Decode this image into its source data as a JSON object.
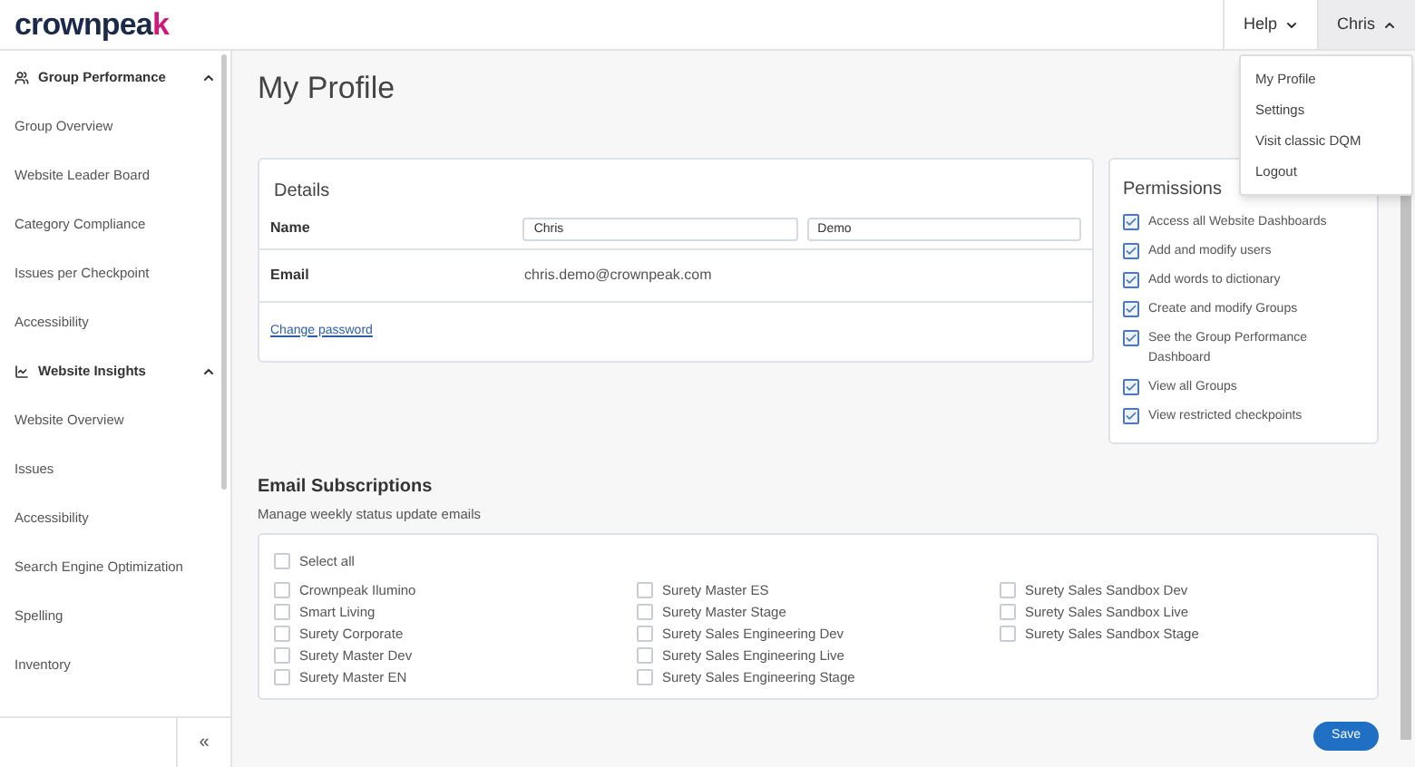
{
  "logo": {
    "text": "crownpea",
    "accent": "k"
  },
  "header_menus": [
    {
      "label": "Help",
      "expanded": false
    },
    {
      "label": "Chris",
      "expanded": true
    }
  ],
  "user_menu": {
    "items": [
      "My Profile",
      "Settings",
      "Visit classic DQM",
      "Logout"
    ]
  },
  "sidebar": {
    "sections": [
      {
        "title": "Group Performance",
        "kind": "people",
        "expanded": true,
        "items": [
          "Group Overview",
          "Website Leader Board",
          "Category Compliance",
          "Issues per Checkpoint",
          "Accessibility"
        ]
      },
      {
        "title": "Website Insights",
        "kind": "insights",
        "expanded": true,
        "items": [
          "Website Overview",
          "Issues",
          "Accessibility",
          "Search Engine Optimization",
          "Spelling",
          "Inventory"
        ]
      }
    ],
    "collapse_label": "«"
  },
  "page_title": "My Profile",
  "details": {
    "title": "Details",
    "name_label": "Name",
    "first_name": "Chris",
    "last_name": "Demo",
    "email_label": "Email",
    "email": "chris.demo@crownpeak.com",
    "change_password": "Change password"
  },
  "permissions": {
    "title": "Permissions",
    "items": [
      {
        "label": "Access all Website Dashboards",
        "checked": true
      },
      {
        "label": "Add and modify users",
        "checked": true
      },
      {
        "label": "Add words to dictionary",
        "checked": true
      },
      {
        "label": "Create and modify Groups",
        "checked": true
      },
      {
        "label": "See the Group Performance Dashboard",
        "checked": true
      },
      {
        "label": "View all Groups",
        "checked": true
      },
      {
        "label": "View restricted checkpoints",
        "checked": true
      }
    ]
  },
  "email_subscriptions": {
    "title": "Email Subscriptions",
    "subtitle": "Manage weekly status update emails",
    "select_all": {
      "label": "Select all",
      "checked": false
    },
    "columns": [
      [
        {
          "label": "Crownpeak Ilumino",
          "checked": false
        },
        {
          "label": "Smart Living",
          "checked": false
        },
        {
          "label": "Surety Corporate",
          "checked": false
        },
        {
          "label": "Surety Master Dev",
          "checked": false
        },
        {
          "label": "Surety Master EN",
          "checked": false
        }
      ],
      [
        {
          "label": "Surety Master ES",
          "checked": false
        },
        {
          "label": "Surety Master Stage",
          "checked": false
        },
        {
          "label": "Surety Sales Engineering Dev",
          "checked": false
        },
        {
          "label": "Surety Sales Engineering Live",
          "checked": false
        },
        {
          "label": "Surety Sales Engineering Stage",
          "checked": false
        }
      ],
      [
        {
          "label": "Surety Sales Sandbox Dev",
          "checked": false
        },
        {
          "label": "Surety Sales Sandbox Live",
          "checked": false
        },
        {
          "label": "Surety Sales Sandbox Stage",
          "checked": false
        }
      ]
    ]
  },
  "save_button": "Save"
}
